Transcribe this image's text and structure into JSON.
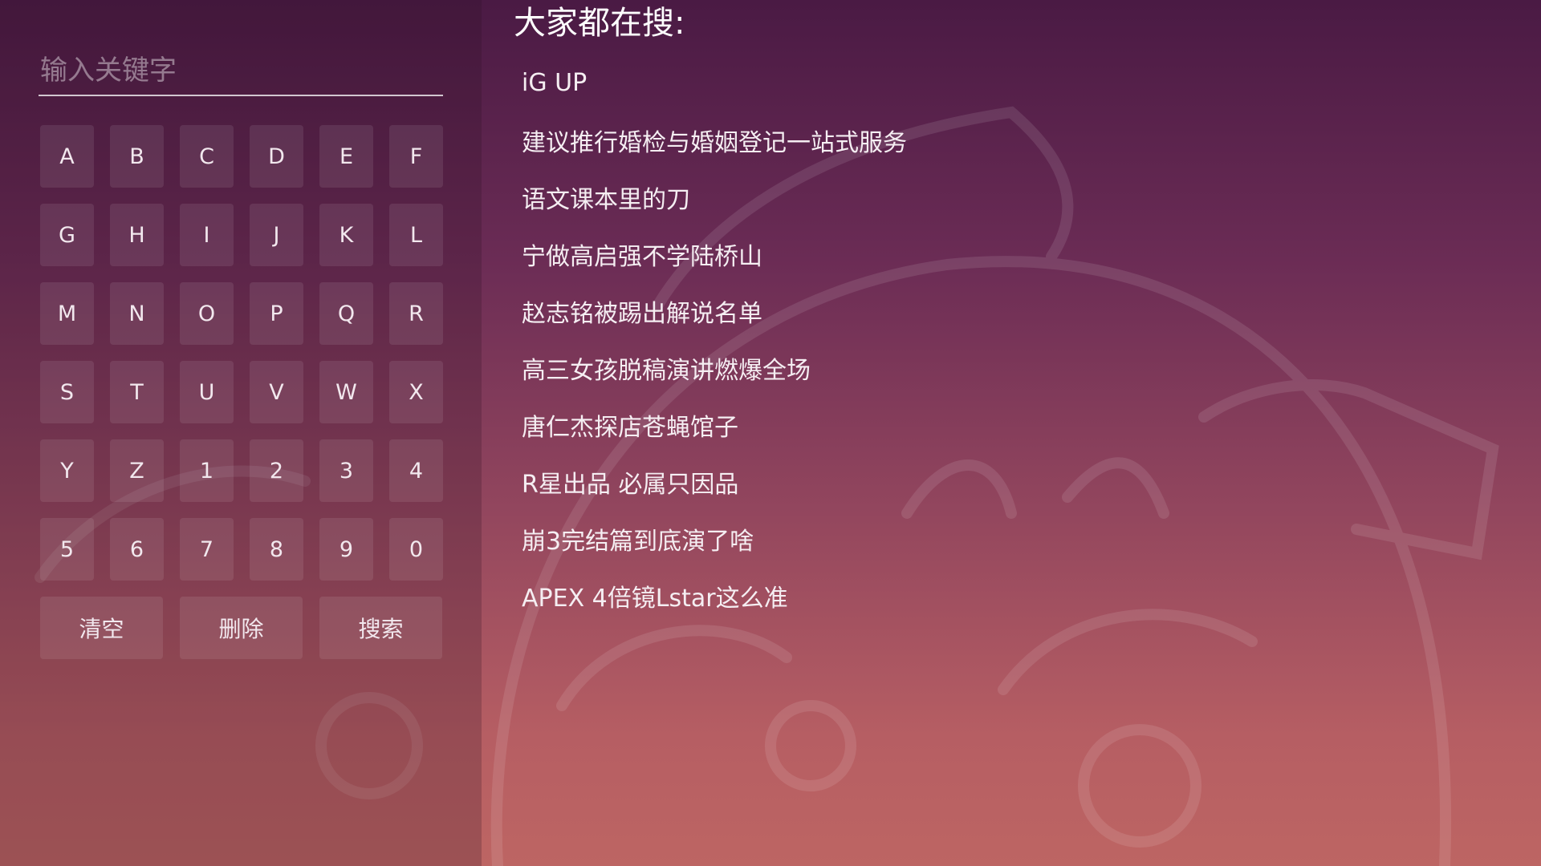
{
  "search": {
    "placeholder": "输入关键字",
    "value": ""
  },
  "keyboard": {
    "keys": [
      "A",
      "B",
      "C",
      "D",
      "E",
      "F",
      "G",
      "H",
      "I",
      "J",
      "K",
      "L",
      "M",
      "N",
      "O",
      "P",
      "Q",
      "R",
      "S",
      "T",
      "U",
      "V",
      "W",
      "X",
      "Y",
      "Z",
      "1",
      "2",
      "3",
      "4",
      "5",
      "6",
      "7",
      "8",
      "9",
      "0"
    ],
    "actions": {
      "clear_label": "清空",
      "delete_label": "删除",
      "search_label": "搜索"
    }
  },
  "hot": {
    "title": "大家都在搜:",
    "items": [
      "iG UP",
      "建议推行婚检与婚姻登记一站式服务",
      "语文课本里的刀",
      "宁做高启强不学陆桥山",
      "赵志铭被踢出解说名单",
      "高三女孩脱稿演讲燃爆全场",
      "唐仁杰探店苍蝇馆子",
      "R星出品 必属只因品",
      "崩3完结篇到底演了啥",
      "APEX 4倍镜Lstar这么准"
    ]
  },
  "colors": {
    "bg_top": "#4a1a44",
    "bg_bottom": "#bd6563",
    "key_bg": "rgba(255,255,255,0.09)"
  }
}
